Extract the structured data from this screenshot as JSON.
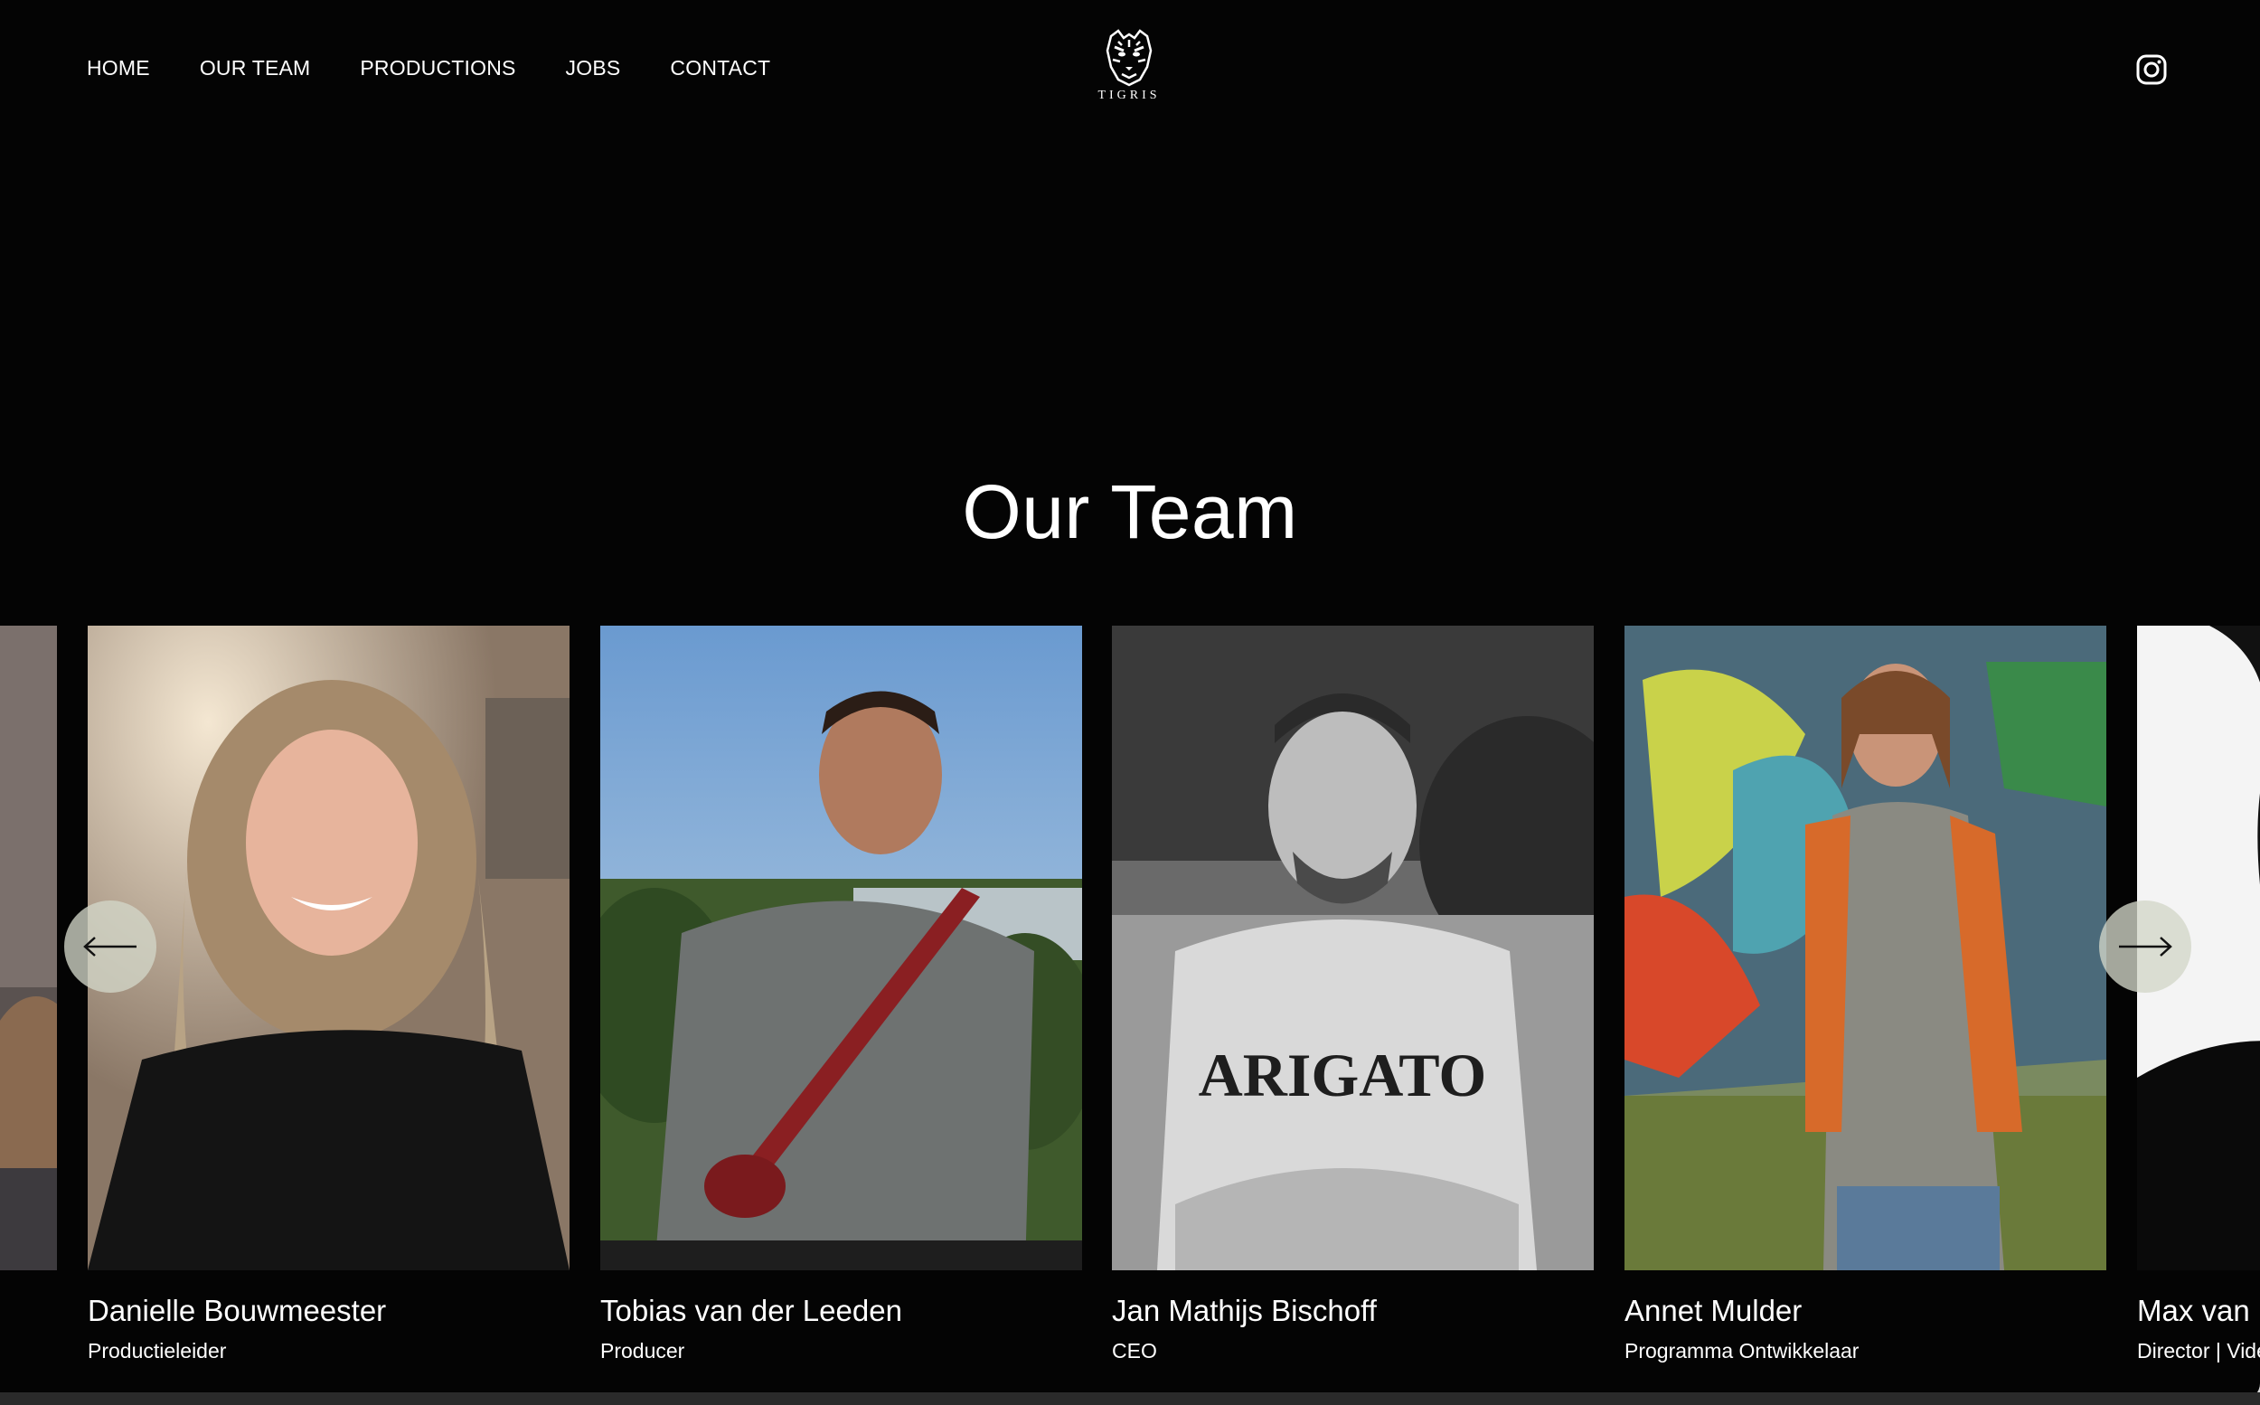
{
  "nav": {
    "items": [
      "HOME",
      "OUR TEAM",
      "PRODUCTIONS",
      "JOBS",
      "CONTACT"
    ]
  },
  "logo": {
    "text": "TIGRIS",
    "icon": "tiger-head-icon"
  },
  "social": {
    "icon": "instagram-icon"
  },
  "page": {
    "heading": "Our Team"
  },
  "team": [
    {
      "name": "Danielle Bouwmeester",
      "role": "Productieleider"
    },
    {
      "name": "Tobias van der Leeden",
      "role": "Producer"
    },
    {
      "name": "Jan Mathijs Bischoff",
      "role": "CEO"
    },
    {
      "name": "Annet Mulder",
      "role": "Programma Ontwikkelaar"
    },
    {
      "name": "Max van N",
      "role": "Director | Vide"
    }
  ],
  "controls": {
    "prev_icon": "arrow-left-icon",
    "next_icon": "arrow-right-icon"
  },
  "colors": {
    "background": "#040404",
    "text": "#ffffff",
    "arrow_bg": "#d2d6c8"
  }
}
